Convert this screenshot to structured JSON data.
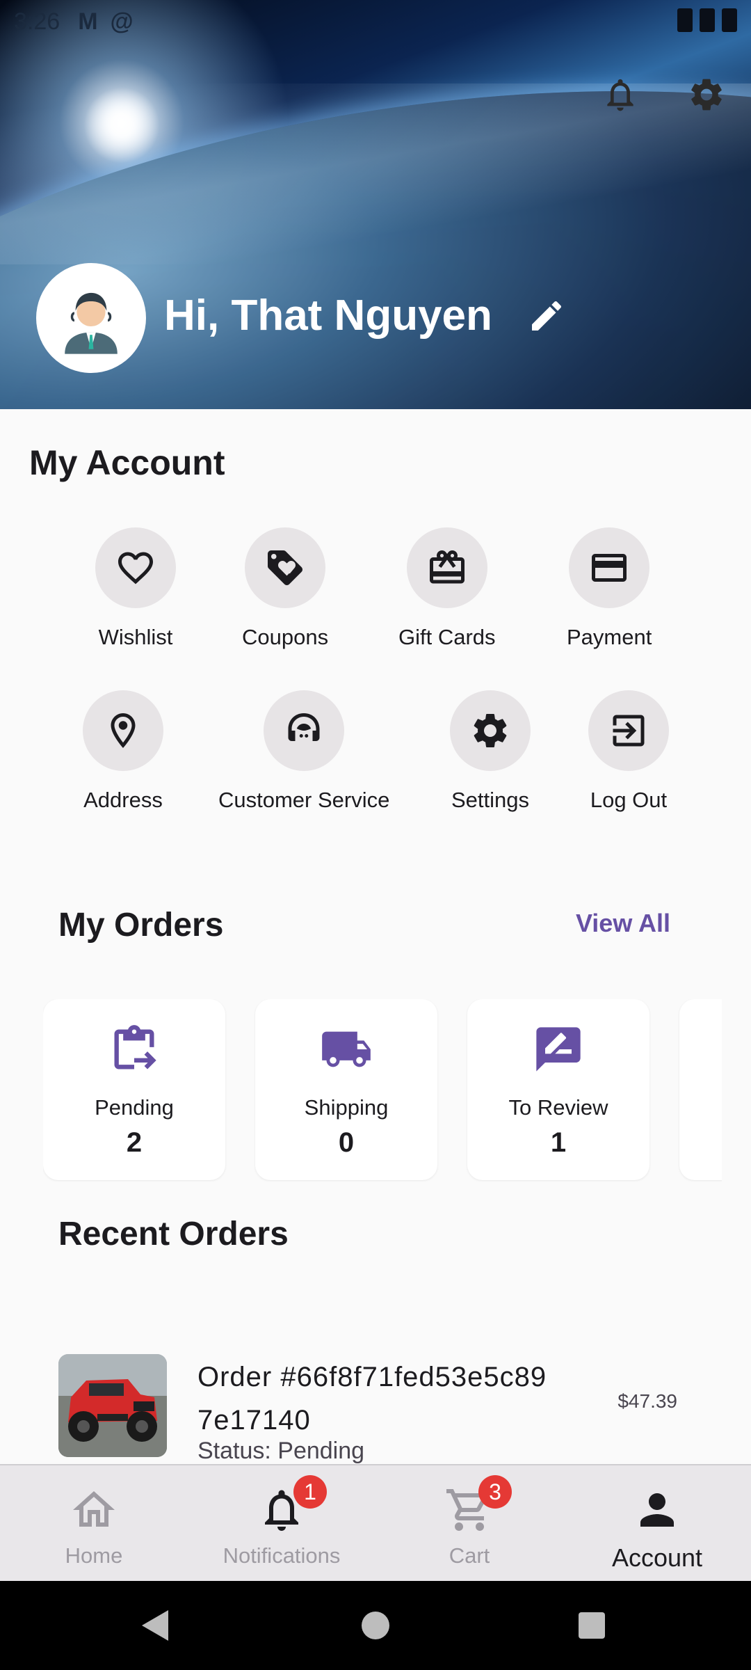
{
  "status_bar": {
    "time": "3:26",
    "icons": [
      "gmail-icon",
      "at-sign-icon",
      "wifi-icon",
      "signal-icon",
      "battery-icon"
    ]
  },
  "header": {
    "greeting": "Hi, That Nguyen",
    "icons": {
      "notifications": "bell-icon",
      "settings": "gear-icon",
      "edit": "pencil-icon"
    }
  },
  "account": {
    "title": "My Account",
    "items": [
      {
        "label": "Wishlist",
        "icon": "heart-icon"
      },
      {
        "label": "Coupons",
        "icon": "tag-icon"
      },
      {
        "label": "Gift Cards",
        "icon": "gift-card-icon"
      },
      {
        "label": "Payment",
        "icon": "credit-card-icon"
      },
      {
        "label": "Address",
        "icon": "location-pin-icon"
      },
      {
        "label": "Customer Service",
        "icon": "headset-icon"
      },
      {
        "label": "Settings",
        "icon": "gear-icon"
      },
      {
        "label": "Log Out",
        "icon": "logout-icon"
      }
    ]
  },
  "orders": {
    "title": "My Orders",
    "view_all": "View All",
    "cards": [
      {
        "label": "Pending",
        "count": "2",
        "icon": "clipboard-arrow-icon"
      },
      {
        "label": "Shipping",
        "count": "0",
        "icon": "truck-icon"
      },
      {
        "label": "To Review",
        "count": "1",
        "icon": "rate-review-icon"
      }
    ]
  },
  "recent_orders": {
    "title": "Recent Orders",
    "items": [
      {
        "title": "Order #66f8f71fed53e5c89 7e17140",
        "status": "Status: Pending",
        "price": "$47.39"
      }
    ]
  },
  "bottom_nav": {
    "items": [
      {
        "label": "Home",
        "icon": "home-icon"
      },
      {
        "label": "Notifications",
        "icon": "bell-icon",
        "badge": "1"
      },
      {
        "label": "Cart",
        "icon": "cart-icon",
        "badge": "3"
      },
      {
        "label": "Account",
        "icon": "person-icon",
        "active": true
      }
    ]
  },
  "colors": {
    "accent": "#6650a4",
    "badge": "#e53935",
    "icon_circle": "#e7e4e6",
    "nav_bg": "#e9e7ea"
  }
}
